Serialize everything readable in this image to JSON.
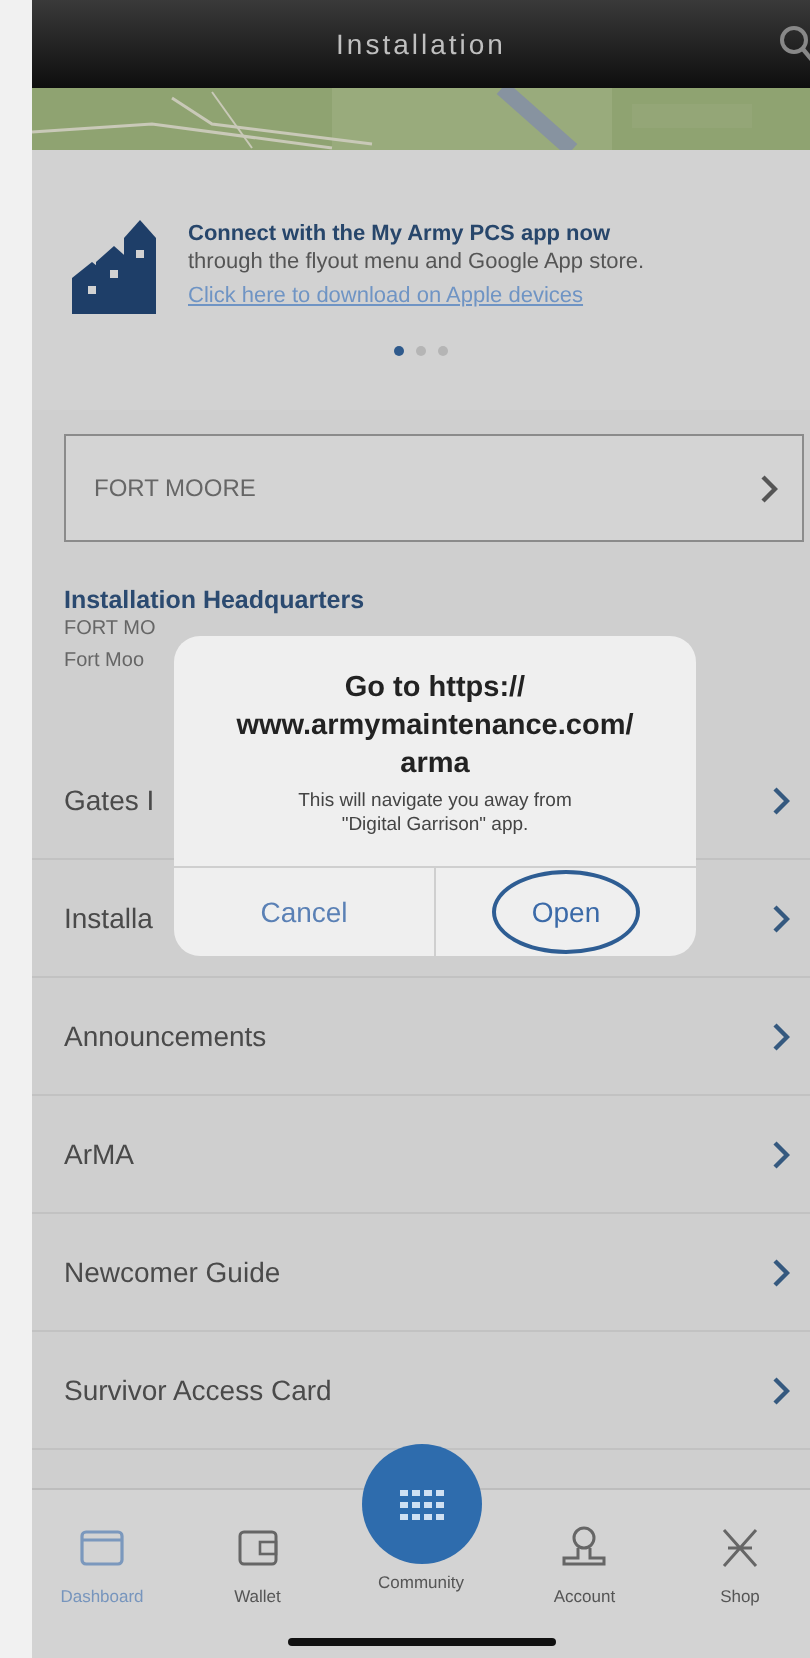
{
  "header": {
    "title": "Installation"
  },
  "promo": {
    "title": "Connect with the My Army PCS app now",
    "text": "through the flyout menu and Google App store.",
    "link": "Click here to download on Apple devices",
    "pages": [
      {
        "selected": true
      },
      {
        "selected": false
      },
      {
        "selected": false
      }
    ]
  },
  "installation_selector": {
    "value": "FORT MOORE"
  },
  "headquarters": {
    "title": "Installation Headquarters",
    "lines": [
      "FORT MO",
      "Fort Moo"
    ]
  },
  "menu": [
    {
      "label": "Gates I"
    },
    {
      "label": "Installa"
    },
    {
      "label": "Announcements"
    },
    {
      "label": "ArMA"
    },
    {
      "label": "Newcomer Guide"
    },
    {
      "label": "Survivor Access Card"
    }
  ],
  "dialog": {
    "title": "Go to https://\nwww.armymaintenance.com/\narma",
    "message": "This will navigate you away from\n\"Digital Garrison\" app.",
    "buttons": [
      {
        "label": "Cancel",
        "kind": "cancel",
        "circled": false
      },
      {
        "label": "Open",
        "kind": "default",
        "circled": true
      }
    ]
  },
  "tab_bar": {
    "tabs": [
      {
        "label": "Dashboard",
        "selected": true
      },
      {
        "label": "Wallet",
        "selected": false
      },
      {
        "label": "Community",
        "selected": false
      },
      {
        "label": "Account",
        "selected": false
      },
      {
        "label": "Shop",
        "selected": false
      }
    ]
  }
}
